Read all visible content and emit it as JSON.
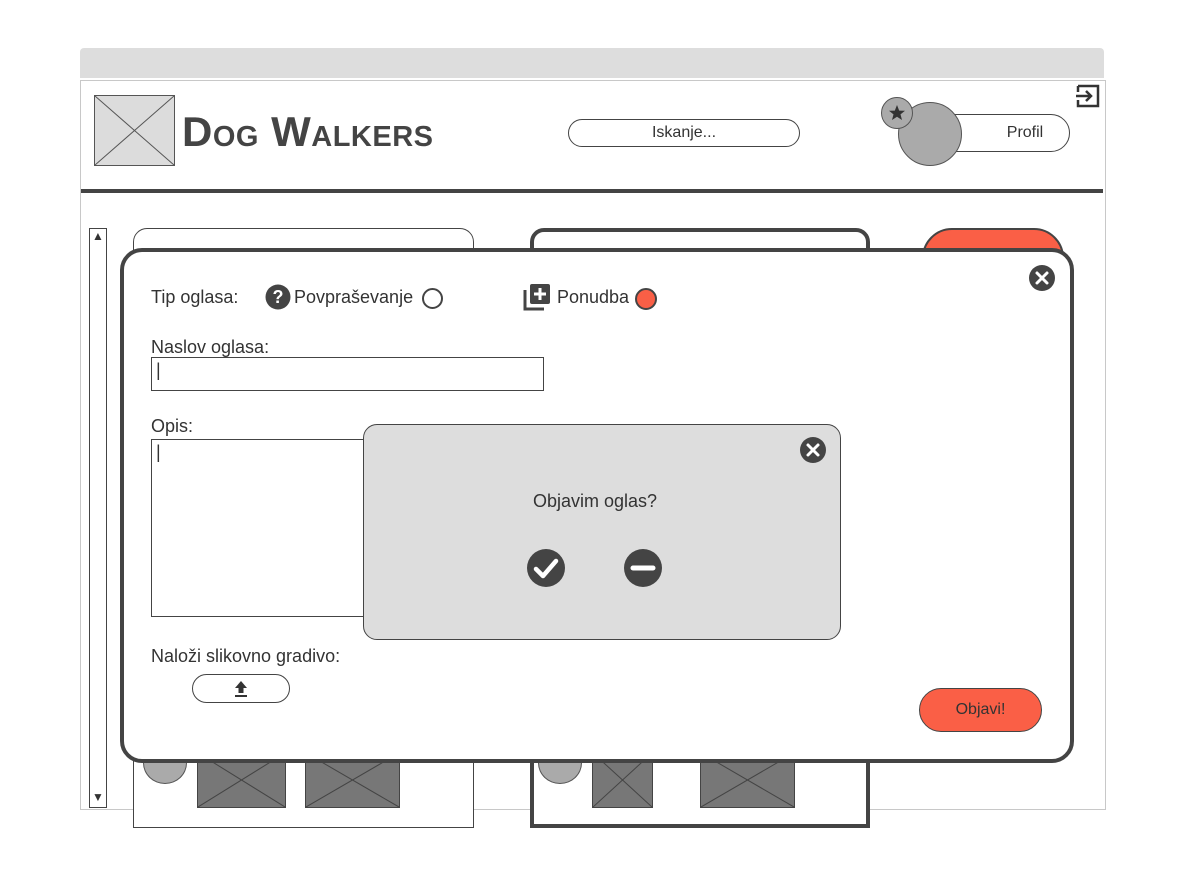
{
  "header": {
    "title": "Dog Walkers",
    "search_placeholder": "Iskanje...",
    "profile_label": "Profil"
  },
  "modal": {
    "type_label": "Tip oglasa:",
    "option_request": "Povpraševanje",
    "option_offer": "Ponudba",
    "selected_option": "Ponudba",
    "title_label": "Naslov oglasa:",
    "title_value": "|",
    "description_label": "Opis:",
    "description_value": "|",
    "upload_label": "Naloži slikovno gradivo:",
    "submit_label": "Objavi!"
  },
  "confirm": {
    "question": "Objavim oglas?"
  },
  "colors": {
    "accent": "#fa5f46",
    "dark": "#444444",
    "panel": "#dddddd"
  },
  "icons": [
    "logout-icon",
    "star-icon",
    "close-icon",
    "question-icon",
    "add-box-icon",
    "upload-icon",
    "check-icon",
    "minus-icon",
    "scroll-up-icon",
    "scroll-down-icon"
  ]
}
